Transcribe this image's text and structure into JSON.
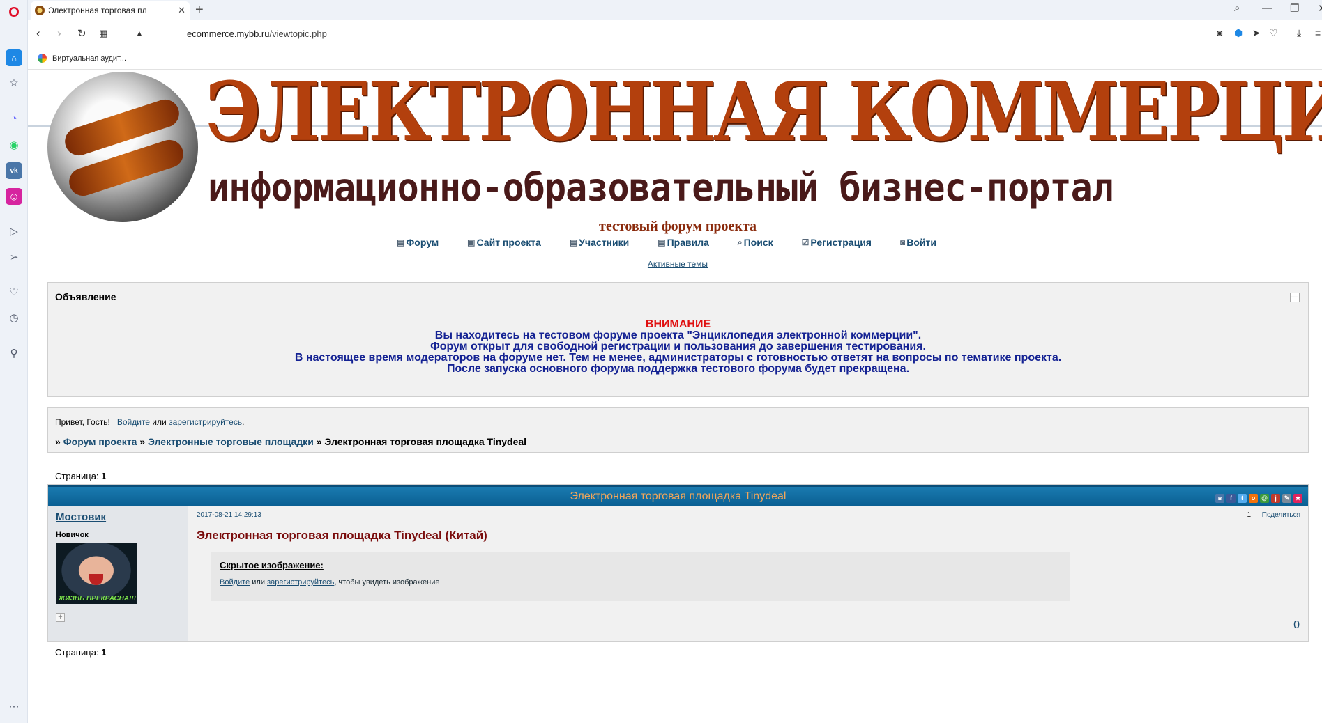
{
  "browser": {
    "tab_title": "Электронная торговая пл",
    "url_host": "ecommerce.mybb.ru",
    "url_path": "/viewtopic.php",
    "bookmark_label": "Виртуальная аудит..."
  },
  "header": {
    "banner_title": "ЭЛЕКТРОННАЯ КОММЕРЦИЯ",
    "banner_subtitle": "информационно-образовательный бизнес-портал",
    "subtitle": "тестовый форум проекта"
  },
  "nav": {
    "items": [
      {
        "label": "Форум"
      },
      {
        "label": "Сайт проекта"
      },
      {
        "label": "Участники"
      },
      {
        "label": "Правила"
      },
      {
        "label": "Поиск"
      },
      {
        "label": "Регистрация"
      },
      {
        "label": "Войти"
      }
    ],
    "active_topics": "Активные темы"
  },
  "announcement": {
    "label": "Объявление",
    "warning": "ВНИМАНИЕ",
    "lines": [
      "Вы находитесь на тестовом форуме проекта \"Энциклопедия электронной коммерции\".",
      "Форум открыт для свободной регистрации и пользования до завершения тестирования.",
      "В настоящее время модераторов на форуме нет. Тем не менее, администраторы с готовностью ответят на вопросы по тематике проекта.",
      "После запуска основного форума поддержка тестового форума будет прекращена."
    ]
  },
  "greeting": {
    "prefix": "Привет, Гость!",
    "login": "Войдите",
    "or": "или",
    "register": "зарегистрируйтесь",
    "suffix": "."
  },
  "breadcrumb": {
    "sep": "»",
    "items": [
      "Форум проекта",
      "Электронные торговые площадки"
    ],
    "current": "Электронная торговая площадка Tinydeal"
  },
  "pager": {
    "label": "Страница:",
    "current": "1"
  },
  "topic": {
    "title": "Электронная торговая площадка Tinydeal",
    "share_icons": [
      "vk",
      "facebook",
      "twitter",
      "odnoklassniki",
      "mailru",
      "livejournal",
      "liveinternet",
      "bookmark"
    ]
  },
  "post": {
    "author": "Мостовик",
    "rank": "Новичок",
    "avatar_caption": "ЖИЗНЬ ПРЕКРАСНА!!!",
    "date": "2017-08-21 14:29:13",
    "number": "1",
    "share": "Поделиться",
    "title": "Электронная торговая площадка Tinydeal (Китай)",
    "hidden_title": "Скрытое изображение:",
    "hidden_login": "Войдите",
    "hidden_or": "или",
    "hidden_register": "зарегистрируйтесь",
    "hidden_suffix": ", чтобы увидеть изображение",
    "likes": "0"
  }
}
